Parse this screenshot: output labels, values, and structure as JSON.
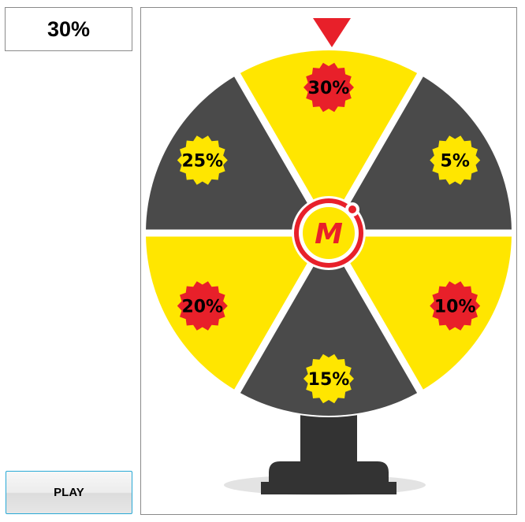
{
  "result": {
    "text": "30%"
  },
  "play_button": {
    "label": "PLAY"
  },
  "wheel": {
    "segments": [
      {
        "label": "30%",
        "fill": "#ffe600",
        "badge": "#e8202a"
      },
      {
        "label": "5%",
        "fill": "#4a4a4a",
        "badge": "#ffe600"
      },
      {
        "label": "10%",
        "fill": "#ffe600",
        "badge": "#e8202a"
      },
      {
        "label": "15%",
        "fill": "#4a4a4a",
        "badge": "#ffe600"
      },
      {
        "label": "20%",
        "fill": "#ffe600",
        "badge": "#e8202a"
      },
      {
        "label": "25%",
        "fill": "#4a4a4a",
        "badge": "#ffe600"
      }
    ],
    "hub_logo": "M",
    "pointer_color": "#e8202a",
    "hub_color": "#e8202a",
    "stand_color": "#333333"
  }
}
